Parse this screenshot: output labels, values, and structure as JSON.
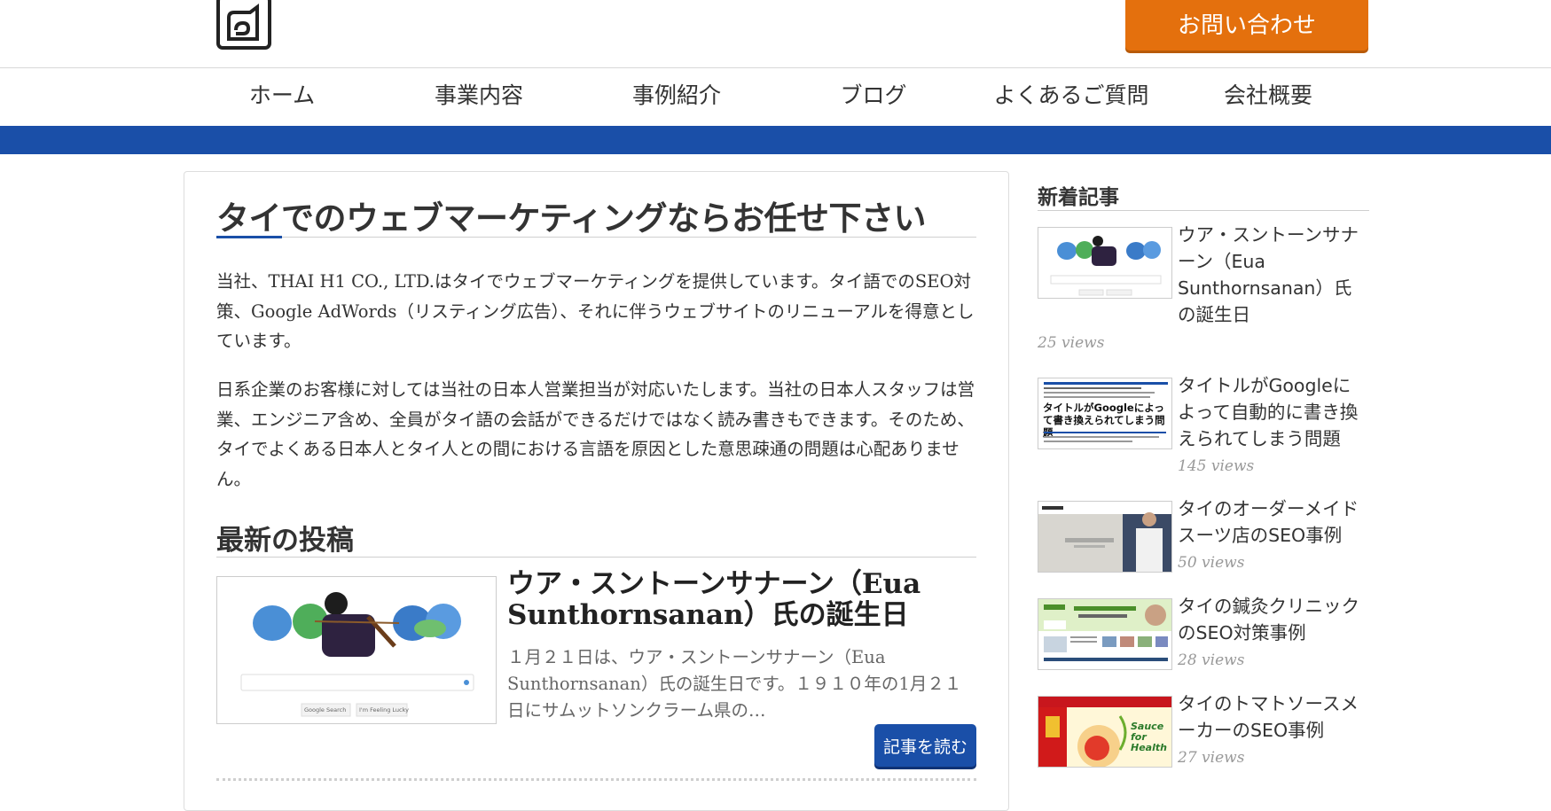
{
  "header": {
    "logo_icon": "logo-icon",
    "contact_label": "お問い合わせ",
    "accent_color": "#e4700d",
    "brand_color": "#1a4fa8"
  },
  "nav": {
    "items": [
      {
        "label": "ホーム"
      },
      {
        "label": "事業内容"
      },
      {
        "label": "事例紹介"
      },
      {
        "label": "ブログ"
      },
      {
        "label": "よくあるご質問"
      },
      {
        "label": "会社概要"
      }
    ]
  },
  "main": {
    "title": "タイでのウェブマーケティングならお任せ下さい",
    "paragraphs": [
      "当社、THAI H1 CO., LTD.はタイでウェブマーケティングを提供しています。タイ語でのSEO対策、Google AdWords（リスティング広告）、それに伴うウェブサイトのリニューアルを得意としています。",
      "日系企業のお客様に対しては当社の日本人営業担当が対応いたします。当社の日本人スタッフは営業、エンジニア含め、全員がタイ語の会話ができるだけではなく読み書きもできます。そのため、タイでよくある日本人とタイ人との間における言語を原因とした意思疎通の問題は心配ありません。"
    ],
    "latest_heading": "最新の投稿",
    "latest_post": {
      "title": "ウア・スントーンサナーン（Eua Sunthornsanan）氏の誕生日",
      "excerpt": "１月２１日は、ウア・スントーンサナーン（Eua Sunthornsanan）氏の誕生日です。１９１０年の1月２１日にサムットソンクラーム県の…",
      "read_more": "記事を読む",
      "thumb_buttons": [
        "Google Search",
        "I'm Feeling Lucky"
      ]
    }
  },
  "sidebar": {
    "title": "新着記事",
    "items": [
      {
        "title": "ウア・スントーンサナーン（Eua Sunthornsanan）氏の誕生日",
        "views": "25 views"
      },
      {
        "title": "タイトルがGoogleによって自動的に書き換えられてしまう問題",
        "views": "145 views",
        "thumb_text": "タイトルがGoogleによって書き換えられてしまう問題"
      },
      {
        "title": "タイのオーダーメイドスーツ店のSEO事例",
        "views": "50 views"
      },
      {
        "title": "タイの鍼灸クリニックのSEO対策事例",
        "views": "28 views"
      },
      {
        "title": "タイのトマトソースメーカーのSEO事例",
        "views": "27 views",
        "thumb_text": "Sauce for Health"
      }
    ]
  }
}
